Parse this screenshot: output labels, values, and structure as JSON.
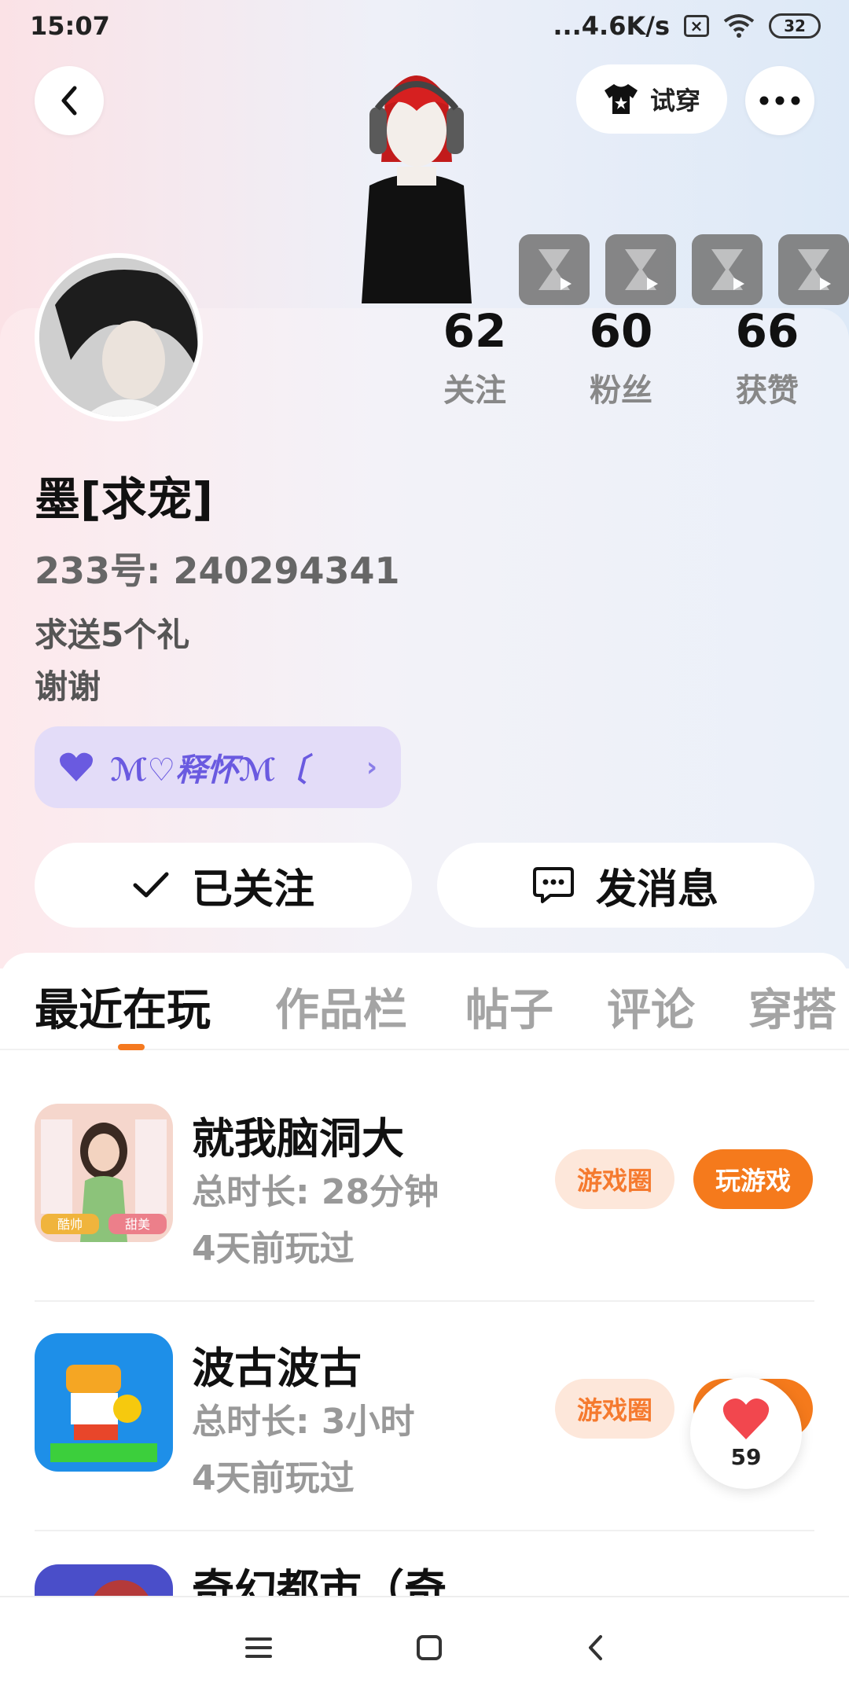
{
  "status_bar": {
    "time": "15:07",
    "network_speed": "...4.6K/s",
    "sim_icon_label": "×",
    "battery": "32"
  },
  "header": {
    "tryon_label": "试穿"
  },
  "stats": [
    {
      "value": "62",
      "label": "关注"
    },
    {
      "value": "60",
      "label": "粉丝"
    },
    {
      "value": "66",
      "label": "获赞"
    }
  ],
  "profile": {
    "nickname": "墨[求宠]",
    "id_line": "233号: 240294341",
    "bio_line1": "求送5个礼",
    "bio_line2": "谢谢",
    "cp_label": "ℳ♡释怀ℳ〔"
  },
  "actions": {
    "follow_label": "已关注",
    "message_label": "发消息"
  },
  "tabs": [
    {
      "label": "最近在玩",
      "active": true
    },
    {
      "label": "作品栏",
      "active": false
    },
    {
      "label": "帖子",
      "active": false
    },
    {
      "label": "评论",
      "active": false
    },
    {
      "label": "穿搭",
      "active": false
    }
  ],
  "games": [
    {
      "title": "就我脑洞大",
      "duration": "总时长: 28分钟",
      "last_played": "4天前玩过",
      "circle_label": "游戏圈",
      "play_label": "玩游戏",
      "tag_left": "酷帅",
      "tag_right": "甜美"
    },
    {
      "title": "波古波古",
      "duration": "总时长: 3小时",
      "last_played": "4天前玩过",
      "circle_label": "游戏圈",
      "play_label": "玩游戏"
    },
    {
      "title": "奇幻都市（奇..."
    }
  ],
  "like_widget": {
    "count": "59"
  },
  "colors": {
    "accent": "#f57a1c",
    "accent_soft": "#fde7da",
    "cp_purple": "#6a5ae0"
  }
}
